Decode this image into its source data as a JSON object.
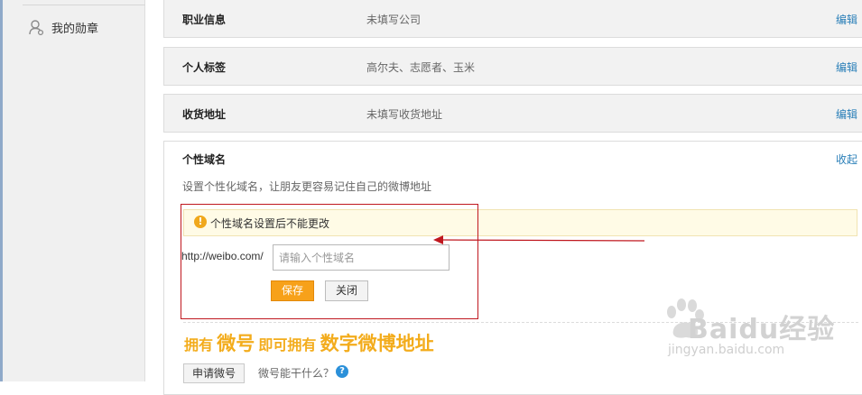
{
  "sidebar": {
    "items": [
      {
        "label": "我的勋章",
        "icon": "user-badge-icon"
      }
    ]
  },
  "sections": [
    {
      "title": "职业信息",
      "value": "未填写公司",
      "action": "编辑"
    },
    {
      "title": "个人标签",
      "value": "高尔夫、志愿者、玉米",
      "action": "编辑"
    },
    {
      "title": "收货地址",
      "value": "未填写收货地址",
      "action": "编辑"
    }
  ],
  "domain": {
    "title": "个性域名",
    "collapse": "收起",
    "description": "设置个性化域名，让朋友更容易记住自己的微博地址",
    "warning": "个性域名设置后不能更改",
    "prefix": "http://weibo.com/",
    "input_value": "",
    "input_placeholder": "请输入个性域名",
    "save_label": "保存",
    "close_label": "关闭"
  },
  "promo": {
    "part1": "拥有",
    "part2": "微号",
    "part3": "即可拥有",
    "part4": "数字微博地址",
    "apply_label": "申请微号",
    "question": "微号能干什么？",
    "help_glyph": "?"
  },
  "watermark": {
    "brand": "Baidu经验",
    "url": "jingyan.baidu.com"
  },
  "colors": {
    "link": "#2a7fb8",
    "accent": "#f7a11a",
    "annotation": "#c0181f",
    "promo": "#f3ac1c"
  }
}
